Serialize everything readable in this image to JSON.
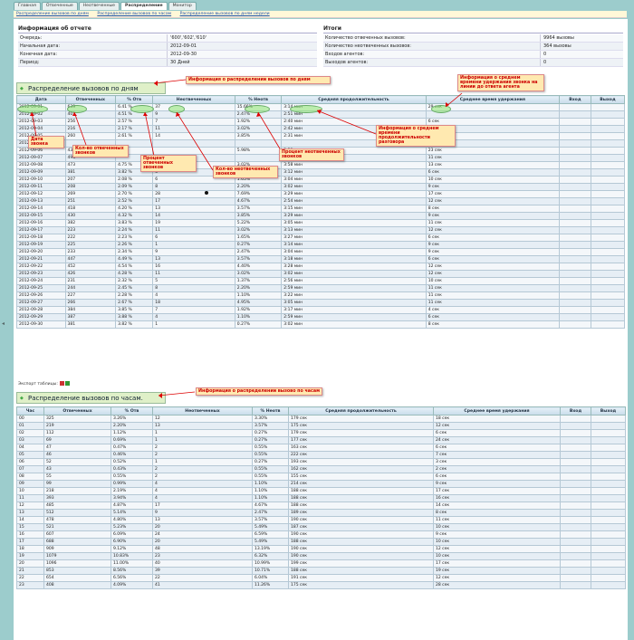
{
  "tabs": [
    "Главная",
    "Отвеченные",
    "Неотвеченные",
    "Распределение",
    "Монитор"
  ],
  "breadcrumbs": [
    "Распределение вызовов по дням",
    "Распределение вызовов по часам",
    "Распределение вызовов по дням недели"
  ],
  "report_info": {
    "title": "Информация об отчете",
    "rows": [
      [
        "Очередь:",
        "'600','602','610'"
      ],
      [
        "Начальная дата:",
        "2012-09-01"
      ],
      [
        "Конечная дата:",
        "2012-09-30"
      ],
      [
        "Период:",
        "30 Дней"
      ]
    ]
  },
  "totals": {
    "title": "Итоги",
    "rows": [
      [
        "Количество отвеченных вызовов:",
        "9964 вызовы"
      ],
      [
        "Количество неотвеченных вызовов:",
        "364 вызовы"
      ],
      [
        "Входов агентов:",
        "0"
      ],
      [
        "Выходов агентов:",
        "0"
      ]
    ]
  },
  "days_section": {
    "title": "Распределение вызовов по дням"
  },
  "day_headers": [
    "Дата",
    "Отвеченных",
    "% Отв",
    "Неотвеченных",
    "% Неотв",
    "Средняя продолжительность",
    "Среднее время удержания",
    "Вход",
    "Выход"
  ],
  "day_rows": [
    [
      "2012-09-01",
      "639",
      "6.41 %",
      "37",
      "15.66%",
      "3:14 мин",
      "29 сек",
      "",
      ""
    ],
    [
      "2012-09-02",
      "401",
      "4.51 %",
      "9",
      "2.47%",
      "2:51 мин",
      "",
      "",
      ""
    ],
    [
      "2012-09-03",
      "256",
      "2.57 %",
      "7",
      "1.92%",
      "2:40 мин",
      "6 сек",
      "",
      ""
    ],
    [
      "2012-09-04",
      "216",
      "2.17 %",
      "11",
      "3.02%",
      "2:42 мин",
      "",
      "",
      ""
    ],
    [
      "2012-09-05",
      "260",
      "2.61 %",
      "14",
      "3.85%",
      "2:31 мин",
      "",
      "",
      ""
    ],
    [
      "2012-09-06",
      "",
      "",
      "",
      "",
      "",
      "",
      "",
      ""
    ],
    [
      "2012-09-06",
      "430",
      "",
      "",
      "5.98%",
      "3:39 мин",
      "23 сек",
      "",
      ""
    ],
    [
      "2012-09-07",
      "498",
      "",
      "",
      "",
      "3:42 мин",
      "11 сек",
      "",
      ""
    ],
    [
      "2012-09-08",
      "473",
      "4.75 %",
      "",
      "3.02%",
      "3:58 мин",
      "13 сек",
      "",
      ""
    ],
    [
      "2012-09-09",
      "381",
      "3.82 %",
      "5",
      "1.37%",
      "3:12 мин",
      "6 сек",
      "",
      ""
    ],
    [
      "2012-09-10",
      "207",
      "2.08 %",
      "6",
      "1.65%",
      "3:04 мин",
      "10 сек",
      "",
      ""
    ],
    [
      "2012-09-11",
      "208",
      "2.09 %",
      "8",
      "2.20%",
      "3:02 мин",
      "9 сек",
      "",
      ""
    ],
    [
      "2012-09-12",
      "269",
      "2.70 %",
      "28",
      "7.69%",
      "3:29 мин",
      "17 сек",
      "",
      ""
    ],
    [
      "2012-09-13",
      "251",
      "2.52 %",
      "17",
      "4.67%",
      "2:54 мин",
      "12 сек",
      "",
      ""
    ],
    [
      "2012-09-14",
      "418",
      "4.20 %",
      "13",
      "3.57%",
      "3:15 мин",
      "8 сек",
      "",
      ""
    ],
    [
      "2012-09-15",
      "430",
      "4.32 %",
      "14",
      "3.85%",
      "3:29 мин",
      "9 сек",
      "",
      ""
    ],
    [
      "2012-09-16",
      "382",
      "3.83 %",
      "19",
      "5.22%",
      "3:05 мин",
      "11 сек",
      "",
      ""
    ],
    [
      "2012-09-17",
      "223",
      "2.24 %",
      "11",
      "3.02%",
      "3:13 мин",
      "12 сек",
      "",
      ""
    ],
    [
      "2012-09-18",
      "222",
      "2.23 %",
      "6",
      "1.65%",
      "3:27 мин",
      "6 сек",
      "",
      ""
    ],
    [
      "2012-09-19",
      "225",
      "2.26 %",
      "1",
      "0.27%",
      "3:14 мин",
      "9 сек",
      "",
      ""
    ],
    [
      "2012-09-20",
      "233",
      "2.34 %",
      "9",
      "2.47%",
      "3:04 мин",
      "9 сек",
      "",
      ""
    ],
    [
      "2012-09-21",
      "447",
      "4.49 %",
      "13",
      "3.57%",
      "3:18 мин",
      "6 сек",
      "",
      ""
    ],
    [
      "2012-09-22",
      "452",
      "4.54 %",
      "16",
      "4.40%",
      "3:28 мин",
      "12 сек",
      "",
      ""
    ],
    [
      "2012-09-23",
      "426",
      "4.28 %",
      "11",
      "3.02%",
      "3:02 мин",
      "12 сек",
      "",
      ""
    ],
    [
      "2012-09-24",
      "231",
      "2.32 %",
      "5",
      "1.37%",
      "2:56 мин",
      "10 сек",
      "",
      ""
    ],
    [
      "2012-09-25",
      "244",
      "2.45 %",
      "8",
      "2.20%",
      "2:59 мин",
      "11 сек",
      "",
      ""
    ],
    [
      "2012-09-26",
      "227",
      "2.28 %",
      "4",
      "1.10%",
      "3:22 мин",
      "11 сек",
      "",
      ""
    ],
    [
      "2012-09-27",
      "266",
      "2.67 %",
      "18",
      "4.95%",
      "3:05 мин",
      "11 сек",
      "",
      ""
    ],
    [
      "2012-09-28",
      "384",
      "3.85 %",
      "7",
      "1.92%",
      "3:17 мин",
      "4 сек",
      "",
      ""
    ],
    [
      "2012-09-29",
      "387",
      "3.88 %",
      "4",
      "1.10%",
      "2:59 мин",
      "6 сек",
      "",
      ""
    ],
    [
      "2012-09-30",
      "381",
      "3.82 %",
      "1",
      "0.27%",
      "3:02 мин",
      "8 сек",
      "",
      ""
    ]
  ],
  "export_label": "Экспорт таблицы:",
  "hours_section": {
    "title": "Распределение вызовов по часам."
  },
  "hour_headers": [
    "Час",
    "Отвеченных",
    "% Отв",
    "Неотвеченных",
    "% Неотв",
    "Средняя продолжительность",
    "Среднее время удержания",
    "Вход",
    "Выход"
  ],
  "hour_rows": [
    [
      "00",
      "325",
      "3.26%",
      "12",
      "3.30%",
      "179 сек",
      "18 сек",
      "",
      ""
    ],
    [
      "01",
      "219",
      "2.20%",
      "13",
      "3.57%",
      "175 сек",
      "12 сек",
      "",
      ""
    ],
    [
      "02",
      "112",
      "1.12%",
      "1",
      "0.27%",
      "179 сек",
      "6 сек",
      "",
      ""
    ],
    [
      "03",
      "69",
      "0.69%",
      "1",
      "0.27%",
      "177 сек",
      "24 сек",
      "",
      ""
    ],
    [
      "04",
      "47",
      "0.47%",
      "2",
      "0.55%",
      "163 сек",
      "6 сек",
      "",
      ""
    ],
    [
      "05",
      "46",
      "0.46%",
      "2",
      "0.55%",
      "222 сек",
      "7 сек",
      "",
      ""
    ],
    [
      "06",
      "52",
      "0.52%",
      "1",
      "0.27%",
      "193 сек",
      "3 сек",
      "",
      ""
    ],
    [
      "07",
      "43",
      "0.43%",
      "2",
      "0.55%",
      "162 сек",
      "2 сек",
      "",
      ""
    ],
    [
      "08",
      "55",
      "0.55%",
      "2",
      "0.55%",
      "155 сек",
      "6 сек",
      "",
      ""
    ],
    [
      "09",
      "99",
      "0.99%",
      "4",
      "1.10%",
      "214 сек",
      "9 сек",
      "",
      ""
    ],
    [
      "10",
      "218",
      "2.19%",
      "4",
      "1.10%",
      "188 сек",
      "17 сек",
      "",
      ""
    ],
    [
      "11",
      "393",
      "3.94%",
      "4",
      "1.10%",
      "188 сек",
      "16 сек",
      "",
      ""
    ],
    [
      "12",
      "485",
      "4.87%",
      "17",
      "4.67%",
      "188 сек",
      "14 сек",
      "",
      ""
    ],
    [
      "13",
      "512",
      "5.14%",
      "9",
      "2.47%",
      "189 сек",
      "8 сек",
      "",
      ""
    ],
    [
      "14",
      "478",
      "4.80%",
      "13",
      "3.57%",
      "190 сек",
      "11 сек",
      "",
      ""
    ],
    [
      "15",
      "521",
      "5.23%",
      "20",
      "5.49%",
      "187 сек",
      "10 сек",
      "",
      ""
    ],
    [
      "16",
      "607",
      "6.09%",
      "24",
      "6.59%",
      "190 сек",
      "9 сек",
      "",
      ""
    ],
    [
      "17",
      "688",
      "6.90%",
      "20",
      "5.49%",
      "188 сек",
      "10 сек",
      "",
      ""
    ],
    [
      "18",
      "909",
      "9.12%",
      "48",
      "13.19%",
      "190 сек",
      "12 сек",
      "",
      ""
    ],
    [
      "19",
      "1079",
      "10.83%",
      "23",
      "6.32%",
      "190 сек",
      "10 сек",
      "",
      ""
    ],
    [
      "20",
      "1096",
      "11.00%",
      "40",
      "10.99%",
      "199 сек",
      "17 сек",
      "",
      ""
    ],
    [
      "21",
      "853",
      "8.56%",
      "39",
      "10.71%",
      "188 сек",
      "19 сек",
      "",
      ""
    ],
    [
      "22",
      "654",
      "6.56%",
      "22",
      "6.04%",
      "191 сек",
      "12 сек",
      "",
      ""
    ],
    [
      "23",
      "408",
      "4.09%",
      "41",
      "11.26%",
      "175 сек",
      "28 сек",
      "",
      ""
    ]
  ],
  "annotations": {
    "days_info": "Информация о распределении вызовов по дням",
    "hold_info": "Информация о среднем времени удержания звонка на линии до ответа агента",
    "duration_info": "Информация о среднем времени продолжительности разговора",
    "call_date": "Дата звонка",
    "answered_count": "Кол-во отвеченных звонков",
    "answered_pct": "Процент отвеченных звонков",
    "missed_count": "Кол-во неотвеченных звонков",
    "missed_pct": "Процент неотвеченных звонков",
    "hours_info": "Информация о распределении вызово по часам"
  },
  "colors": {
    "annotation_text": "#cc0000",
    "annotation_bg": "#ffe9b0",
    "highlight": "#8ce66e",
    "header_bg": "#c8dcea",
    "section_bg": "#dff0c8"
  }
}
